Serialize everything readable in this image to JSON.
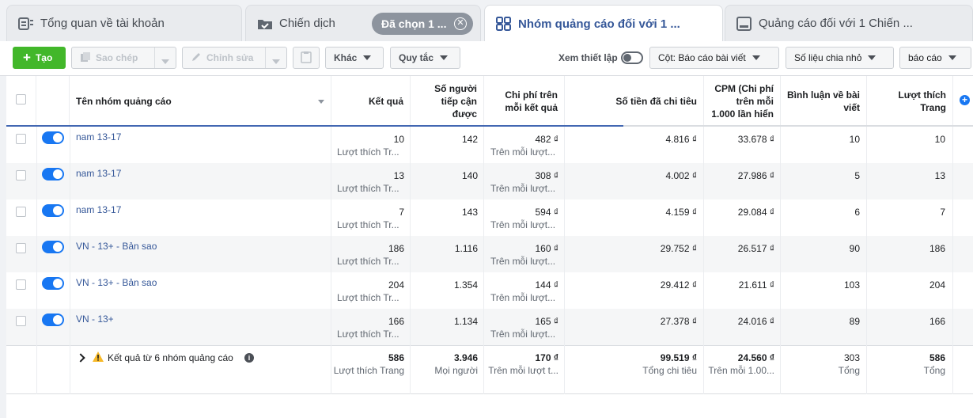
{
  "tabs": [
    {
      "label": "Tổng quan về tài khoản"
    },
    {
      "label": "Chiến dịch"
    },
    {
      "label": "Nhóm quảng cáo đối với 1 ..."
    },
    {
      "label": "Quảng cáo đối với 1 Chiến ..."
    }
  ],
  "selected_chip": "Đã chọn 1 ...",
  "toolbar": {
    "create": "Tạo",
    "copy": "Sao chép",
    "edit": "Chỉnh sửa",
    "more": "Khác",
    "rules": "Quy tắc",
    "view_setup": "Xem thiết lập",
    "columns": "Cột: Báo cáo bài viết",
    "breakdown": "Số liệu chia nhỏ",
    "reports": "báo cáo"
  },
  "headers": {
    "name": "Tên nhóm quảng cáo",
    "results": "Kết quả",
    "reach": [
      "Số người",
      "tiếp cận",
      "được"
    ],
    "cost": [
      "Chi phí trên",
      "mỗi kết quả"
    ],
    "spent": "Số tiền đã chi tiêu",
    "cpm": [
      "CPM (Chi phí",
      "trên mỗi",
      "1.000 lần hiển"
    ],
    "comments": [
      "Bình luận về bài",
      "viết"
    ],
    "likes": [
      "Lượt thích",
      "Trang"
    ]
  },
  "rows": [
    {
      "name": "nam 13-17",
      "results": "10",
      "results_sub": "Lượt thích Tr...",
      "reach": "142",
      "cost": "482 ₫",
      "cost_sub": "Trên mỗi lượt...",
      "spent": "4.816 ₫",
      "cpm": "33.678 ₫",
      "comments": "10",
      "likes": "10"
    },
    {
      "name": "nam 13-17",
      "results": "13",
      "results_sub": "Lượt thích Tr...",
      "reach": "140",
      "cost": "308 ₫",
      "cost_sub": "Trên mỗi lượt...",
      "spent": "4.002 ₫",
      "cpm": "27.986 ₫",
      "comments": "5",
      "likes": "13"
    },
    {
      "name": "nam 13-17",
      "results": "7",
      "results_sub": "Lượt thích Tr...",
      "reach": "143",
      "cost": "594 ₫",
      "cost_sub": "Trên mỗi lượt...",
      "spent": "4.159 ₫",
      "cpm": "29.084 ₫",
      "comments": "6",
      "likes": "7"
    },
    {
      "name": "VN - 13+ - Bản sao",
      "results": "186",
      "results_sub": "Lượt thích Tr...",
      "reach": "1.116",
      "cost": "160 ₫",
      "cost_sub": "Trên mỗi lượt...",
      "spent": "29.752 ₫",
      "cpm": "26.517 ₫",
      "comments": "90",
      "likes": "186"
    },
    {
      "name": "VN - 13+ - Bản sao",
      "results": "204",
      "results_sub": "Lượt thích Tr...",
      "reach": "1.354",
      "cost": "144 ₫",
      "cost_sub": "Trên mỗi lượt...",
      "spent": "29.412 ₫",
      "cpm": "21.611 ₫",
      "comments": "103",
      "likes": "204"
    },
    {
      "name": "VN - 13+",
      "results": "166",
      "results_sub": "Lượt thích Tr...",
      "reach": "1.134",
      "cost": "165 ₫",
      "cost_sub": "Trên mỗi lượt...",
      "spent": "27.378 ₫",
      "cpm": "24.016 ₫",
      "comments": "89",
      "likes": "166"
    }
  ],
  "totals": {
    "label": "Kết quả từ 6 nhóm quảng cáo",
    "results": "586",
    "results_sub": "Lượt thích Trang",
    "reach": "3.946",
    "reach_sub": "Mọi người",
    "cost": "170 ₫",
    "cost_sub": "Trên mỗi lượt t...",
    "spent": "99.519 ₫",
    "spent_sub": "Tổng chi tiêu",
    "cpm": "24.560 ₫",
    "cpm_sub": "Trên mỗi 1.00...",
    "comments": "303",
    "comments_sub": "Tổng",
    "likes": "586",
    "likes_sub": "Tổng"
  },
  "colors": {
    "accent": "#4267b2",
    "toggle_on": "#1877f2",
    "create": "#42b72a",
    "link": "#365899",
    "warning": "#f7b928"
  }
}
